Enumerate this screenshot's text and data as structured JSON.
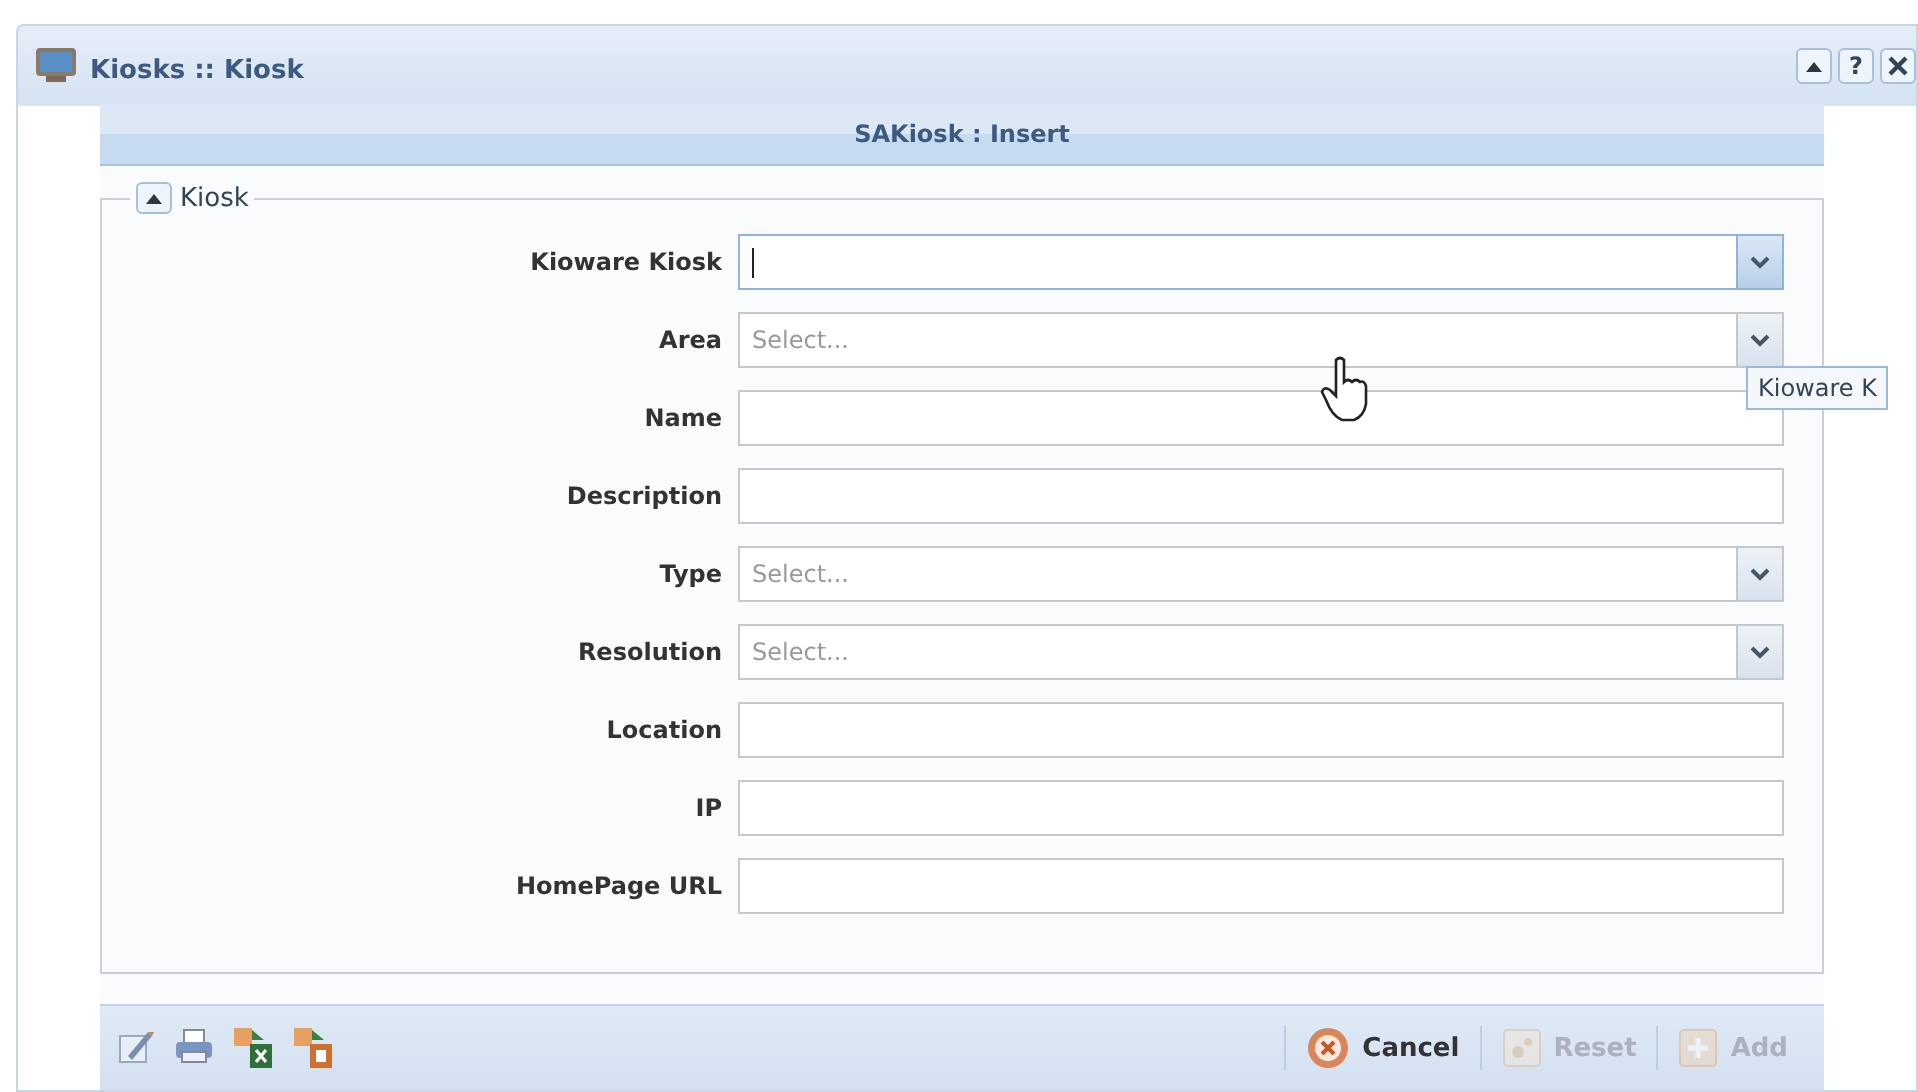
{
  "window": {
    "title": "Kiosks :: Kiosk",
    "buttons": [
      {
        "kind": "collapse"
      },
      {
        "kind": "help",
        "label": "?"
      },
      {
        "kind": "close"
      }
    ]
  },
  "panel": {
    "title": "SAKiosk : Insert"
  },
  "fieldset": {
    "legend": "Kiosk",
    "expanded": true
  },
  "fields": [
    {
      "label": "Kioware Kiosk",
      "kind": "combo",
      "focused": true
    },
    {
      "label": "Area",
      "kind": "combo",
      "placeholder": "Select...",
      "focused": false
    },
    {
      "label": "Name",
      "kind": "text",
      "focused": false
    },
    {
      "label": "Description",
      "kind": "text",
      "focused": false
    },
    {
      "label": "Type",
      "kind": "combo",
      "placeholder": "Select...",
      "focused": false
    },
    {
      "label": "Resolution",
      "kind": "combo",
      "placeholder": "Select...",
      "focused": false
    },
    {
      "label": "Location",
      "kind": "text",
      "focused": false
    },
    {
      "label": "IP",
      "kind": "text",
      "focused": false
    },
    {
      "label": "HomePage URL",
      "kind": "text",
      "focused": false
    }
  ],
  "tooltip": "Kioware K",
  "toolbar": {
    "tools": [
      {
        "kind": "edit"
      },
      {
        "kind": "print"
      },
      {
        "kind": "export-excel"
      },
      {
        "kind": "export-pdf"
      }
    ],
    "actions": [
      {
        "kind": "cancel",
        "label": "Cancel",
        "disabled": false
      },
      {
        "kind": "reset",
        "label": "Reset",
        "disabled": true
      },
      {
        "kind": "add",
        "label": "Add",
        "disabled": true
      }
    ]
  }
}
